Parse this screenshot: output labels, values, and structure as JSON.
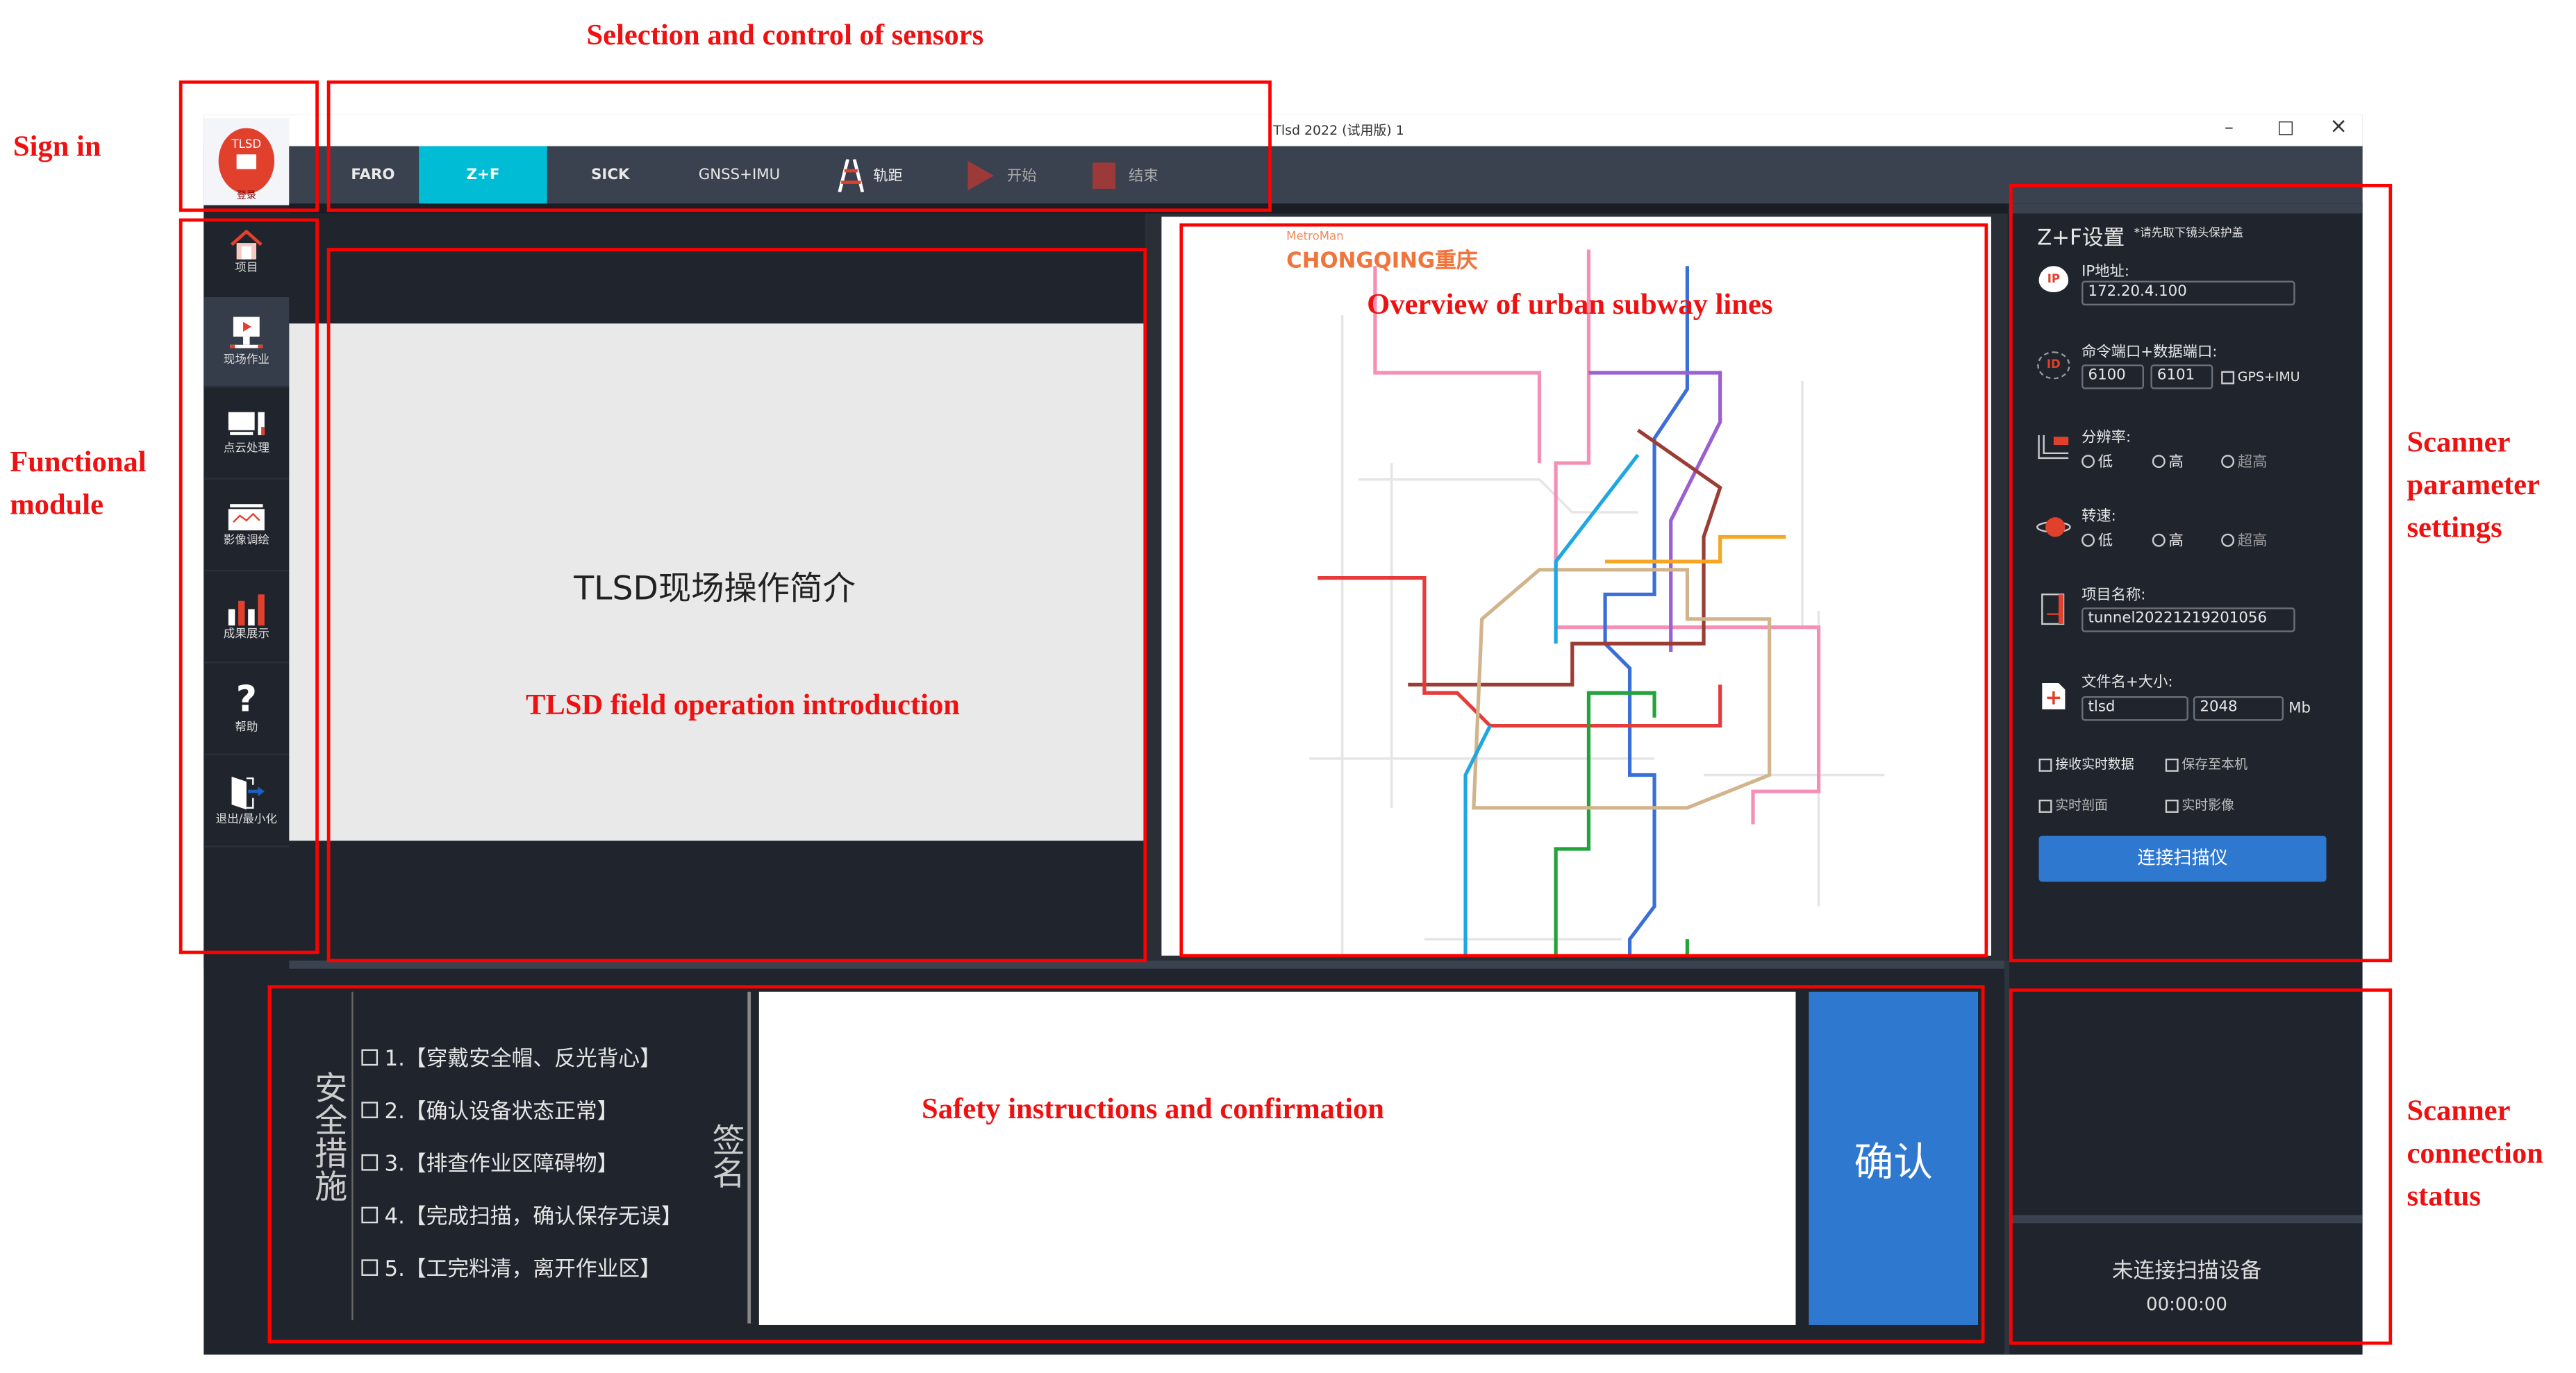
{
  "annotations": {
    "sensors": "Selection and control of sensors",
    "sign_in": "Sign in",
    "functional_module": [
      "Functional",
      "module"
    ],
    "scanner_params": [
      "Scanner",
      "parameter",
      "settings"
    ],
    "scanner_status": [
      "Scanner",
      "connection",
      "status"
    ],
    "subway": "Overview of urban subway lines",
    "intro": "TLSD field operation introduction",
    "safety": "Safety instructions and confirmation"
  },
  "window": {
    "title": "Tlsd 2022 (试用版)  1",
    "controls": {
      "minimize": "–",
      "maximize": "□",
      "close": "×"
    }
  },
  "logo": {
    "text": "TLSD",
    "caption": "登录"
  },
  "toolbar": {
    "tabs": [
      "FARO",
      "Z+F",
      "SICK",
      "GNSS+IMU"
    ],
    "active_tab": "Z+F",
    "track_gauge": "轨距",
    "start": "开始",
    "stop": "结束"
  },
  "sidebar": {
    "items": [
      {
        "label": "项目",
        "icon": "house-icon"
      },
      {
        "label": "现场作业",
        "icon": "field-work-icon",
        "selected": true
      },
      {
        "label": "点云处理",
        "icon": "point-cloud-icon"
      },
      {
        "label": "影像调绘",
        "icon": "image-icon"
      },
      {
        "label": "成果展示",
        "icon": "bar-chart-icon"
      },
      {
        "label": "帮助",
        "icon": "help-icon"
      },
      {
        "label": "退出/最小化",
        "icon": "exit-icon"
      }
    ]
  },
  "intro": {
    "title": "TLSD现场操作简介"
  },
  "map": {
    "brand": "MetroMan",
    "city": "CHONGQING重庆"
  },
  "settings": {
    "title": "Z+F设置",
    "note": "*请先取下镜头保护盖",
    "ip_label": "IP地址:",
    "ip_value": "172.20.4.100",
    "ports_label": "命令端口+数据端口:",
    "cmd_port": "6100",
    "data_port": "6101",
    "gps_imu": "GPS+IMU",
    "resolution_label": "分辨率:",
    "speed_label": "转速:",
    "options": [
      "低",
      "高",
      "超高"
    ],
    "project_label": "项目名称:",
    "project_value": "tunnel20221219201056",
    "file_label": "文件名+大小:",
    "file_name": "tlsd",
    "file_size": "2048",
    "file_unit": "Mb",
    "checks": [
      "接收实时数据",
      "保存至本机",
      "实时剖面",
      "实时影像"
    ],
    "connect_button": "连接扫描仪"
  },
  "safety": {
    "heading": "安全措施",
    "items": [
      "1.【穿戴安全帽、反光背心】",
      "2.【确认设备状态正常】",
      "3.【排查作业区障碍物】",
      "4.【完成扫描，确认保存无误】",
      "5.【工完料清，离开作业区】"
    ],
    "signature_label": "签名",
    "confirm_button": "确认"
  },
  "status": {
    "text": "未连接扫描设备",
    "timer": "00:00:00"
  },
  "colors": {
    "accent_tab": "#00bcd4",
    "button_blue": "#2e78d0",
    "panel": "#20252d",
    "toolbar": "#3a4250",
    "annotation": "#ff0000"
  }
}
